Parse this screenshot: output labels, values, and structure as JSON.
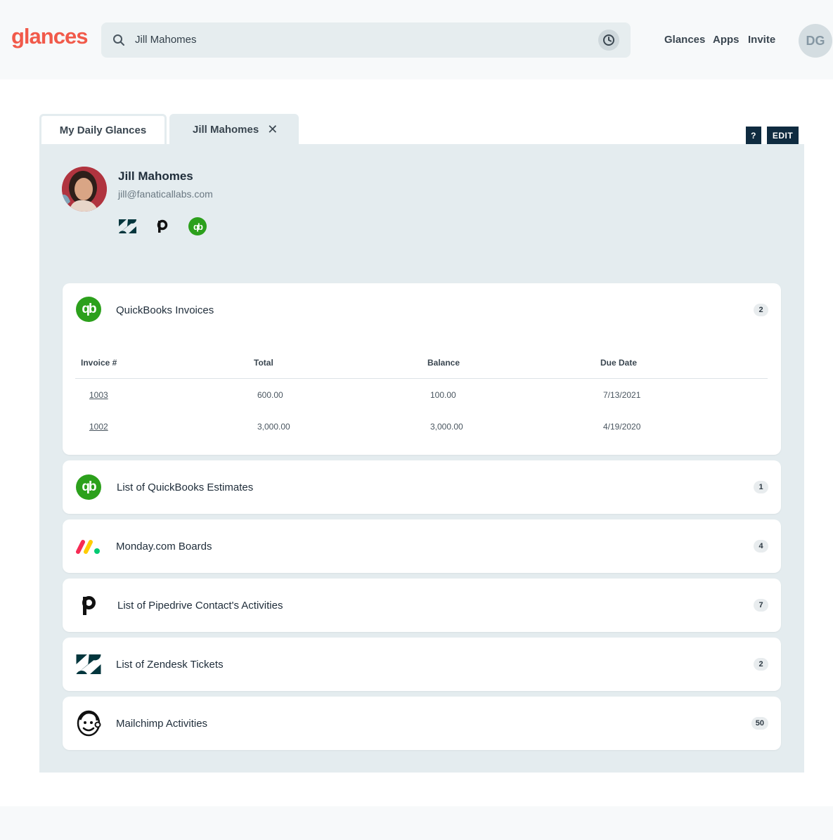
{
  "header": {
    "logo": "glances",
    "search_value": "Jill Mahomes",
    "nav": [
      "Glances",
      "Apps",
      "Invite"
    ],
    "avatar_initials": "DG"
  },
  "tabs": [
    {
      "label": "My Daily Glances"
    },
    {
      "label": "Jill Mahomes",
      "close": "✕"
    }
  ],
  "actions": {
    "help": "?",
    "edit": "EDIT"
  },
  "profile": {
    "name": "Jill Mahomes",
    "email": "jill@fanaticallabs.com",
    "apps": [
      "zendesk-icon",
      "pipedrive-icon",
      "quickbooks-icon"
    ]
  },
  "cards": [
    {
      "title": "QuickBooks Invoices",
      "count": "2",
      "icon": "quickbooks-icon",
      "table": {
        "headers": [
          "Invoice #",
          "Total",
          "Balance",
          "Due Date"
        ],
        "rows": [
          [
            "1003",
            "600.00",
            "100.00",
            "7/13/2021"
          ],
          [
            "1002",
            "3,000.00",
            "3,000.00",
            "4/19/2020"
          ]
        ]
      }
    },
    {
      "title": "List of QuickBooks Estimates",
      "count": "1",
      "icon": "quickbooks-icon"
    },
    {
      "title": "Monday.com Boards",
      "count": "4",
      "icon": "monday-icon"
    },
    {
      "title": "List of Pipedrive Contact's Activities",
      "count": "7",
      "icon": "pipedrive-icon"
    },
    {
      "title": "List of Zendesk Tickets",
      "count": "2",
      "icon": "zendesk-icon"
    },
    {
      "title": "Mailchimp Activities",
      "count": "50",
      "icon": "mailchimp-icon"
    }
  ],
  "colors": {
    "brand": "#f15a4a",
    "panel": "#e4ecef",
    "dark_button": "#0f2b40",
    "quickbooks": "#2ca01c"
  }
}
